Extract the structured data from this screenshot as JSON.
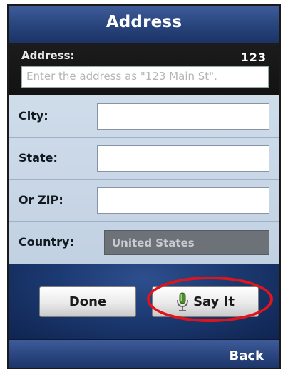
{
  "header": {
    "title": "Address"
  },
  "address": {
    "label": "Address:",
    "input_mode": "123",
    "placeholder": "Enter the address as \"123 Main St\"."
  },
  "form": {
    "city_label": "City:",
    "state_label": "State:",
    "zip_label": "Or ZIP:",
    "country_label": "Country:",
    "country_value": "United States"
  },
  "buttons": {
    "done": "Done",
    "say_it": "Say It"
  },
  "footer": {
    "back": "Back"
  },
  "icons": {
    "say_it": "microphone-icon"
  },
  "colors": {
    "highlight": "#e0141b",
    "title_bar": "#2a4680"
  }
}
